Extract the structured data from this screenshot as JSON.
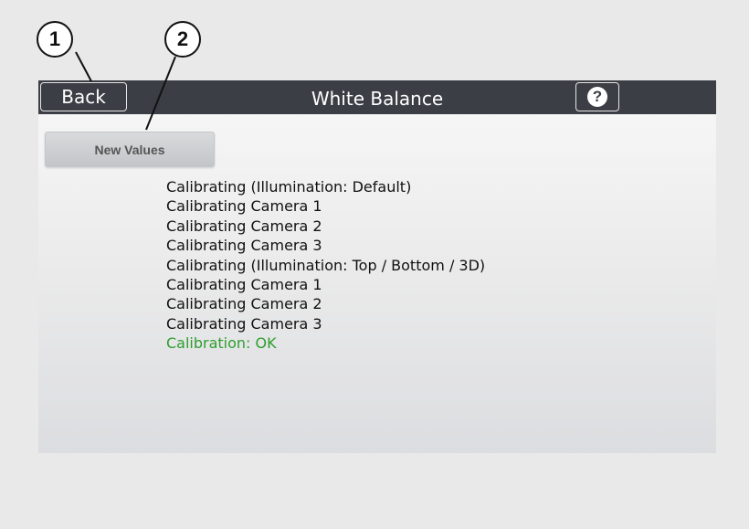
{
  "callouts": [
    "1",
    "2"
  ],
  "titlebar": {
    "back_label": "Back",
    "title": "White Balance",
    "help_label": "?"
  },
  "actions": {
    "new_values_label": "New Values"
  },
  "log": {
    "lines": [
      "Calibrating (Illumination: Default)",
      "Calibrating Camera 1",
      "Calibrating Camera 2",
      "Calibrating Camera 3",
      "Calibrating (Illumination: Top / Bottom / 3D)",
      "Calibrating Camera 1",
      "Calibrating Camera 2",
      "Calibrating Camera 3"
    ],
    "status": "Calibration: OK"
  },
  "colors": {
    "titlebar": "#3b3e45",
    "status_ok": "#2f9e2f"
  }
}
